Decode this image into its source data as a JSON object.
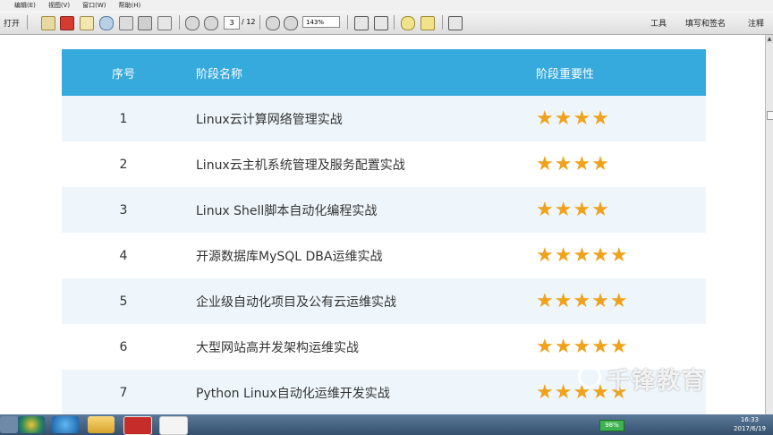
{
  "menu": [
    "编辑(E)",
    "视图(V)",
    "窗口(W)",
    "帮助(H)"
  ],
  "toolbar": {
    "open_label": "打开",
    "page_current": "3",
    "page_total": "/ 12",
    "zoom": "143%",
    "tools_label": "工具",
    "fill_sign_label": "填写和签名",
    "comment_label": "注释"
  },
  "table": {
    "headers": [
      "序号",
      "阶段名称",
      "阶段重要性"
    ],
    "rows": [
      {
        "no": "1",
        "name": "Linux云计算网络管理实战",
        "stars": "★★★★",
        "importance": 4
      },
      {
        "no": "2",
        "name": "Linux云主机系统管理及服务配置实战",
        "stars": "★★★★",
        "importance": 4
      },
      {
        "no": "3",
        "name": "Linux Shell脚本自动化编程实战",
        "stars": "★★★★",
        "importance": 4
      },
      {
        "no": "4",
        "name": "开源数据库MySQL DBA运维实战",
        "stars": "★★★★★",
        "importance": 5
      },
      {
        "no": "5",
        "name": "企业级自动化项目及公有云运维实战",
        "stars": "★★★★★",
        "importance": 5
      },
      {
        "no": "6",
        "name": "大型网站高并发架构运维实战",
        "stars": "★★★★★",
        "importance": 5
      },
      {
        "no": "7",
        "name": "Python Linux自动化运维开发实战",
        "stars": "★★★★★",
        "importance": 5
      }
    ]
  },
  "watermark": {
    "text": "千锋教育",
    "tm": "TM"
  },
  "taskbar": {
    "battery": "98%",
    "time": "16:33",
    "date": "2017/6/19"
  },
  "colors": {
    "header_bg": "#36a9dd",
    "star": "#efa21b",
    "row_alt": "#eef6fb"
  }
}
